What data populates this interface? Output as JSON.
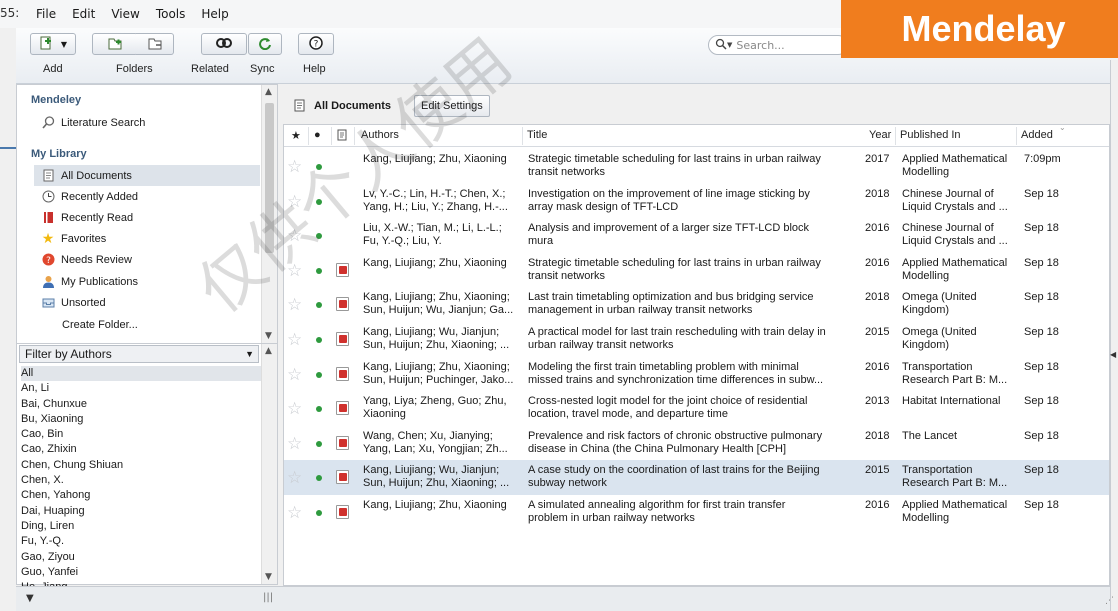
{
  "menubar": {
    "cut_text": "55:",
    "items": [
      "File",
      "Edit",
      "View",
      "Tools",
      "Help"
    ]
  },
  "brand": {
    "text": "Mendelay",
    "color": "#f07d1e"
  },
  "toolbar": {
    "add_label": "Add",
    "folders_label": "Folders",
    "related_label": "Related",
    "sync_label": "Sync",
    "help_label": "Help",
    "search_placeholder": "Search..."
  },
  "sidebar": {
    "mendeley_title": "Mendeley",
    "literature_search": "Literature Search",
    "library_title": "My Library",
    "items": [
      {
        "label": "All Documents",
        "icon": "document-icon",
        "selected": true
      },
      {
        "label": "Recently Added",
        "icon": "clock-icon"
      },
      {
        "label": "Recently Read",
        "icon": "book-icon"
      },
      {
        "label": "Favorites",
        "icon": "star-icon"
      },
      {
        "label": "Needs Review",
        "icon": "question-icon"
      },
      {
        "label": "My Publications",
        "icon": "person-icon"
      },
      {
        "label": "Unsorted",
        "icon": "tray-icon"
      }
    ],
    "create_folder": "Create Folder..."
  },
  "filter": {
    "label": "Filter by Authors",
    "authors": [
      "All",
      "An, Li",
      "Bai, Chunxue",
      "Bu, Xiaoning",
      "Cao, Bin",
      "Cao, Zhixin",
      "Chen, Chung Shiuan",
      "Chen, X.",
      "Chen, Yahong",
      "Dai, Huaping",
      "Ding, Liren",
      "Fu, Y.-Q.",
      "Gao, Ziyou",
      "Guo, Yanfei",
      "He, Jiang"
    ]
  },
  "main": {
    "title": "All Documents",
    "edit_settings": "Edit Settings",
    "columns": {
      "authors": "Authors",
      "title": "Title",
      "year": "Year",
      "published": "Published In",
      "added": "Added"
    },
    "rows": [
      {
        "authors": "Kang, Liujiang; Zhu, Xiaoning",
        "title": "Strategic timetable scheduling for last trains in urban railway transit networks",
        "year": "2017",
        "published": "Applied Mathematical Modelling",
        "added": "7:09pm",
        "pdf": false
      },
      {
        "authors": "Lv, Y.-C.; Lin, H.-T.; Chen, X.; Yang, H.; Liu, Y.; Zhang, H.-...",
        "title": "Investigation on the improvement of line image sticking by array mask design of TFT-LCD",
        "year": "2018",
        "published": "Chinese Journal of Liquid Crystals and ...",
        "added": "Sep 18",
        "pdf": false
      },
      {
        "authors": "Liu, X.-W.; Tian, M.; Li, L.-L.; Fu, Y.-Q.; Liu, Y.",
        "title": "Analysis and improvement of a larger size TFT-LCD block mura",
        "year": "2016",
        "published": "Chinese Journal of Liquid Crystals and ...",
        "added": "Sep 18",
        "pdf": false
      },
      {
        "authors": "Kang, Liujiang; Zhu, Xiaoning",
        "title": "Strategic timetable scheduling for last trains in urban railway transit networks",
        "year": "2016",
        "published": "Applied Mathematical Modelling",
        "added": "Sep 18",
        "pdf": true
      },
      {
        "authors": "Kang, Liujiang; Zhu, Xiaoning; Sun, Huijun; Wu, Jianjun; Ga...",
        "title": "Last train timetabling optimization and bus bridging service management in urban railway transit networks",
        "year": "2018",
        "published": "Omega (United Kingdom)",
        "added": "Sep 18",
        "pdf": true
      },
      {
        "authors": "Kang, Liujiang; Wu, Jianjun; Sun, Huijun; Zhu, Xiaoning; ...",
        "title": "A practical model for last train rescheduling with train delay in urban railway transit networks",
        "year": "2015",
        "published": "Omega (United Kingdom)",
        "added": "Sep 18",
        "pdf": true
      },
      {
        "authors": "Kang, Liujiang; Zhu, Xiaoning; Sun, Huijun; Puchinger, Jako...",
        "title": "Modeling the first train timetabling problem with minimal missed trains and synchronization time differences in subw...",
        "year": "2016",
        "published": "Transportation Research Part B: M...",
        "added": "Sep 18",
        "pdf": true
      },
      {
        "authors": "Yang, Liya; Zheng, Guo; Zhu, Xiaoning",
        "title": "Cross-nested logit model for the joint choice of residential location, travel mode, and departure time",
        "year": "2013",
        "published": "Habitat International",
        "added": "Sep 18",
        "pdf": true
      },
      {
        "authors": "Wang, Chen; Xu, Jianying; Yang, Lan; Xu, Yongjian; Zh...",
        "title": "Prevalence and risk factors of chronic obstructive pulmonary disease in China (the China Pulmonary Health [CPH] study)...",
        "year": "2018",
        "published": "The Lancet",
        "added": "Sep 18",
        "pdf": true
      },
      {
        "authors": "Kang, Liujiang; Wu, Jianjun; Sun, Huijun; Zhu, Xiaoning; ...",
        "title": "A case study on the coordination of last trains for the Beijing subway network",
        "year": "2015",
        "published": "Transportation Research Part B: M...",
        "added": "Sep 18",
        "pdf": true,
        "selected": true
      },
      {
        "authors": "Kang, Liujiang; Zhu, Xiaoning",
        "title": "A simulated annealing algorithm for first train transfer problem in urban railway networks",
        "year": "2016",
        "published": "Applied Mathematical Modelling",
        "added": "Sep 18",
        "pdf": true
      }
    ]
  },
  "watermark": "仅供个人使用"
}
